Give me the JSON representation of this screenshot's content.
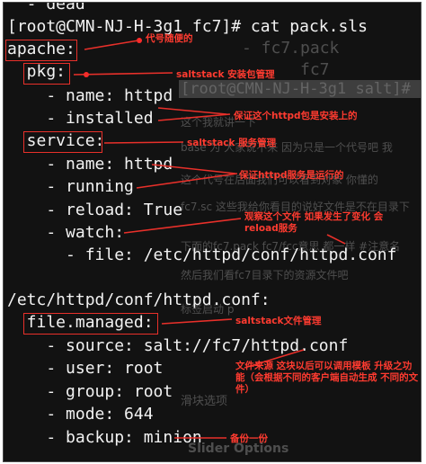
{
  "terminal": {
    "lines": [
      "  - dead",
      "[root@CMN-NJ-H-3g1 fc7]# cat pack.sls",
      "apache:",
      "  pkg:",
      "    - name: httpd",
      "    - installed",
      "  service:",
      "    - name: httpd",
      "    - running",
      "    - reload: True",
      "    - watch:",
      "      - file: /etc/httpd/conf/httpd.conf",
      "/etc/httpd/conf/httpd.conf:",
      "  file.managed:",
      "    - source: salt://fc7/httpd.conf",
      "    - user: root",
      "    - group: root",
      "    - mode: 644",
      "    - backup: minion"
    ]
  },
  "background_text": {
    "fc7_pack": "- fc7.pack",
    "fc7_dir": "fc7",
    "prompt_ghost": "[root@CMN-NJ-H-3g1 salt]#",
    "p1": "这个我就讲一下",
    "p2": "base 为 大家说不来 因为只是一个代号吧 我",
    "p3": "这个代号在后面我们可以看到对象 你懂的",
    "p4": "fc7.sc 这些我给你看目的说好文件是不在目录下",
    "p5": "下面的fc7.pack fc7/fcc意思 都一样 #注意名",
    "p6": "然后我们看fc7目录下的资源文件吧",
    "p7": "标签启动 p",
    "p8": "滑块选项",
    "p9": "Slider Options"
  },
  "annotations": {
    "apache_note": "代号随便的",
    "pkg_note": "saltstack 安装包管理",
    "installed_note": "保证这个httpd包是安装上的",
    "service_note": "saltstack 服务管理",
    "running_note": "保证httpd服务是运行的",
    "watch_note": "观察这个文件 如果发生了变化 会reload服务",
    "file_managed_note": "saltstack文件管理",
    "source_note": "文件来源 这块以后可以调用模板 升级之功能（会根据不同的客户端自动生成 不同的文件）",
    "backup_note": "备份一份"
  },
  "colors": {
    "terminal_bg": "#121212",
    "terminal_text": "#f2f2f2",
    "annotation": "#ff3b30"
  }
}
